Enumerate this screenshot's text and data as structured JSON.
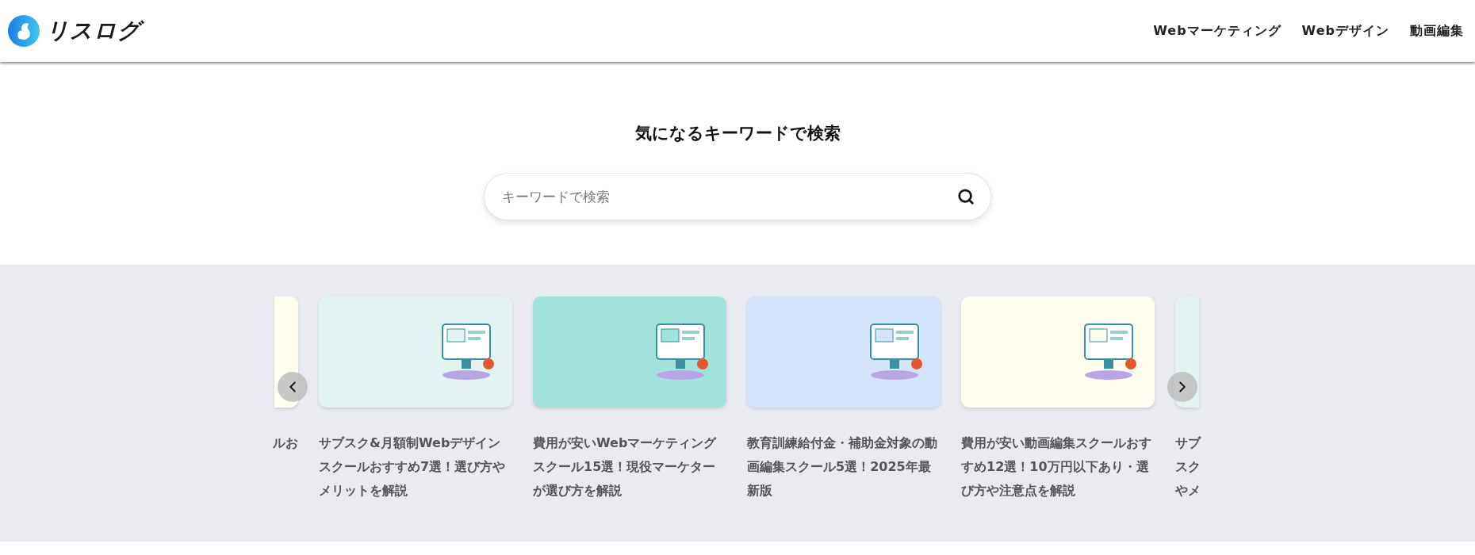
{
  "header": {
    "logo_text": "リスログ",
    "nav": [
      {
        "label": "Webマーケティング"
      },
      {
        "label": "Webデザイン"
      },
      {
        "label": "動画編集"
      }
    ]
  },
  "search": {
    "heading": "気になるキーワードで検索",
    "placeholder": "キーワードで検索"
  },
  "carousel": {
    "cards": [
      {
        "kind": "partial_left",
        "color": "#fffdf0",
        "title": "ルお"
      },
      {
        "kind": "full",
        "color": "#e3f3f1",
        "title": "サブスク&月額制Webデザインスクールおすすめ7選！選び方やメリットを解説"
      },
      {
        "kind": "full",
        "color": "#a1e3dc",
        "title": "費用が安いWebマーケティングスクール15選！現役マーケターが選び方を解説"
      },
      {
        "kind": "full",
        "color": "#d4e5fb",
        "title": "教育訓練給付金・補助金対象の動画編集スクール5選！2025年最新版"
      },
      {
        "kind": "full",
        "color": "#fffdf0",
        "title": "費用が安い動画編集スクールおすすめ12選！10万円以下あり・選び方や注意点を解説"
      },
      {
        "kind": "partial_right",
        "color": "#e3f3f1",
        "title": "サブスクやメ"
      }
    ]
  }
}
